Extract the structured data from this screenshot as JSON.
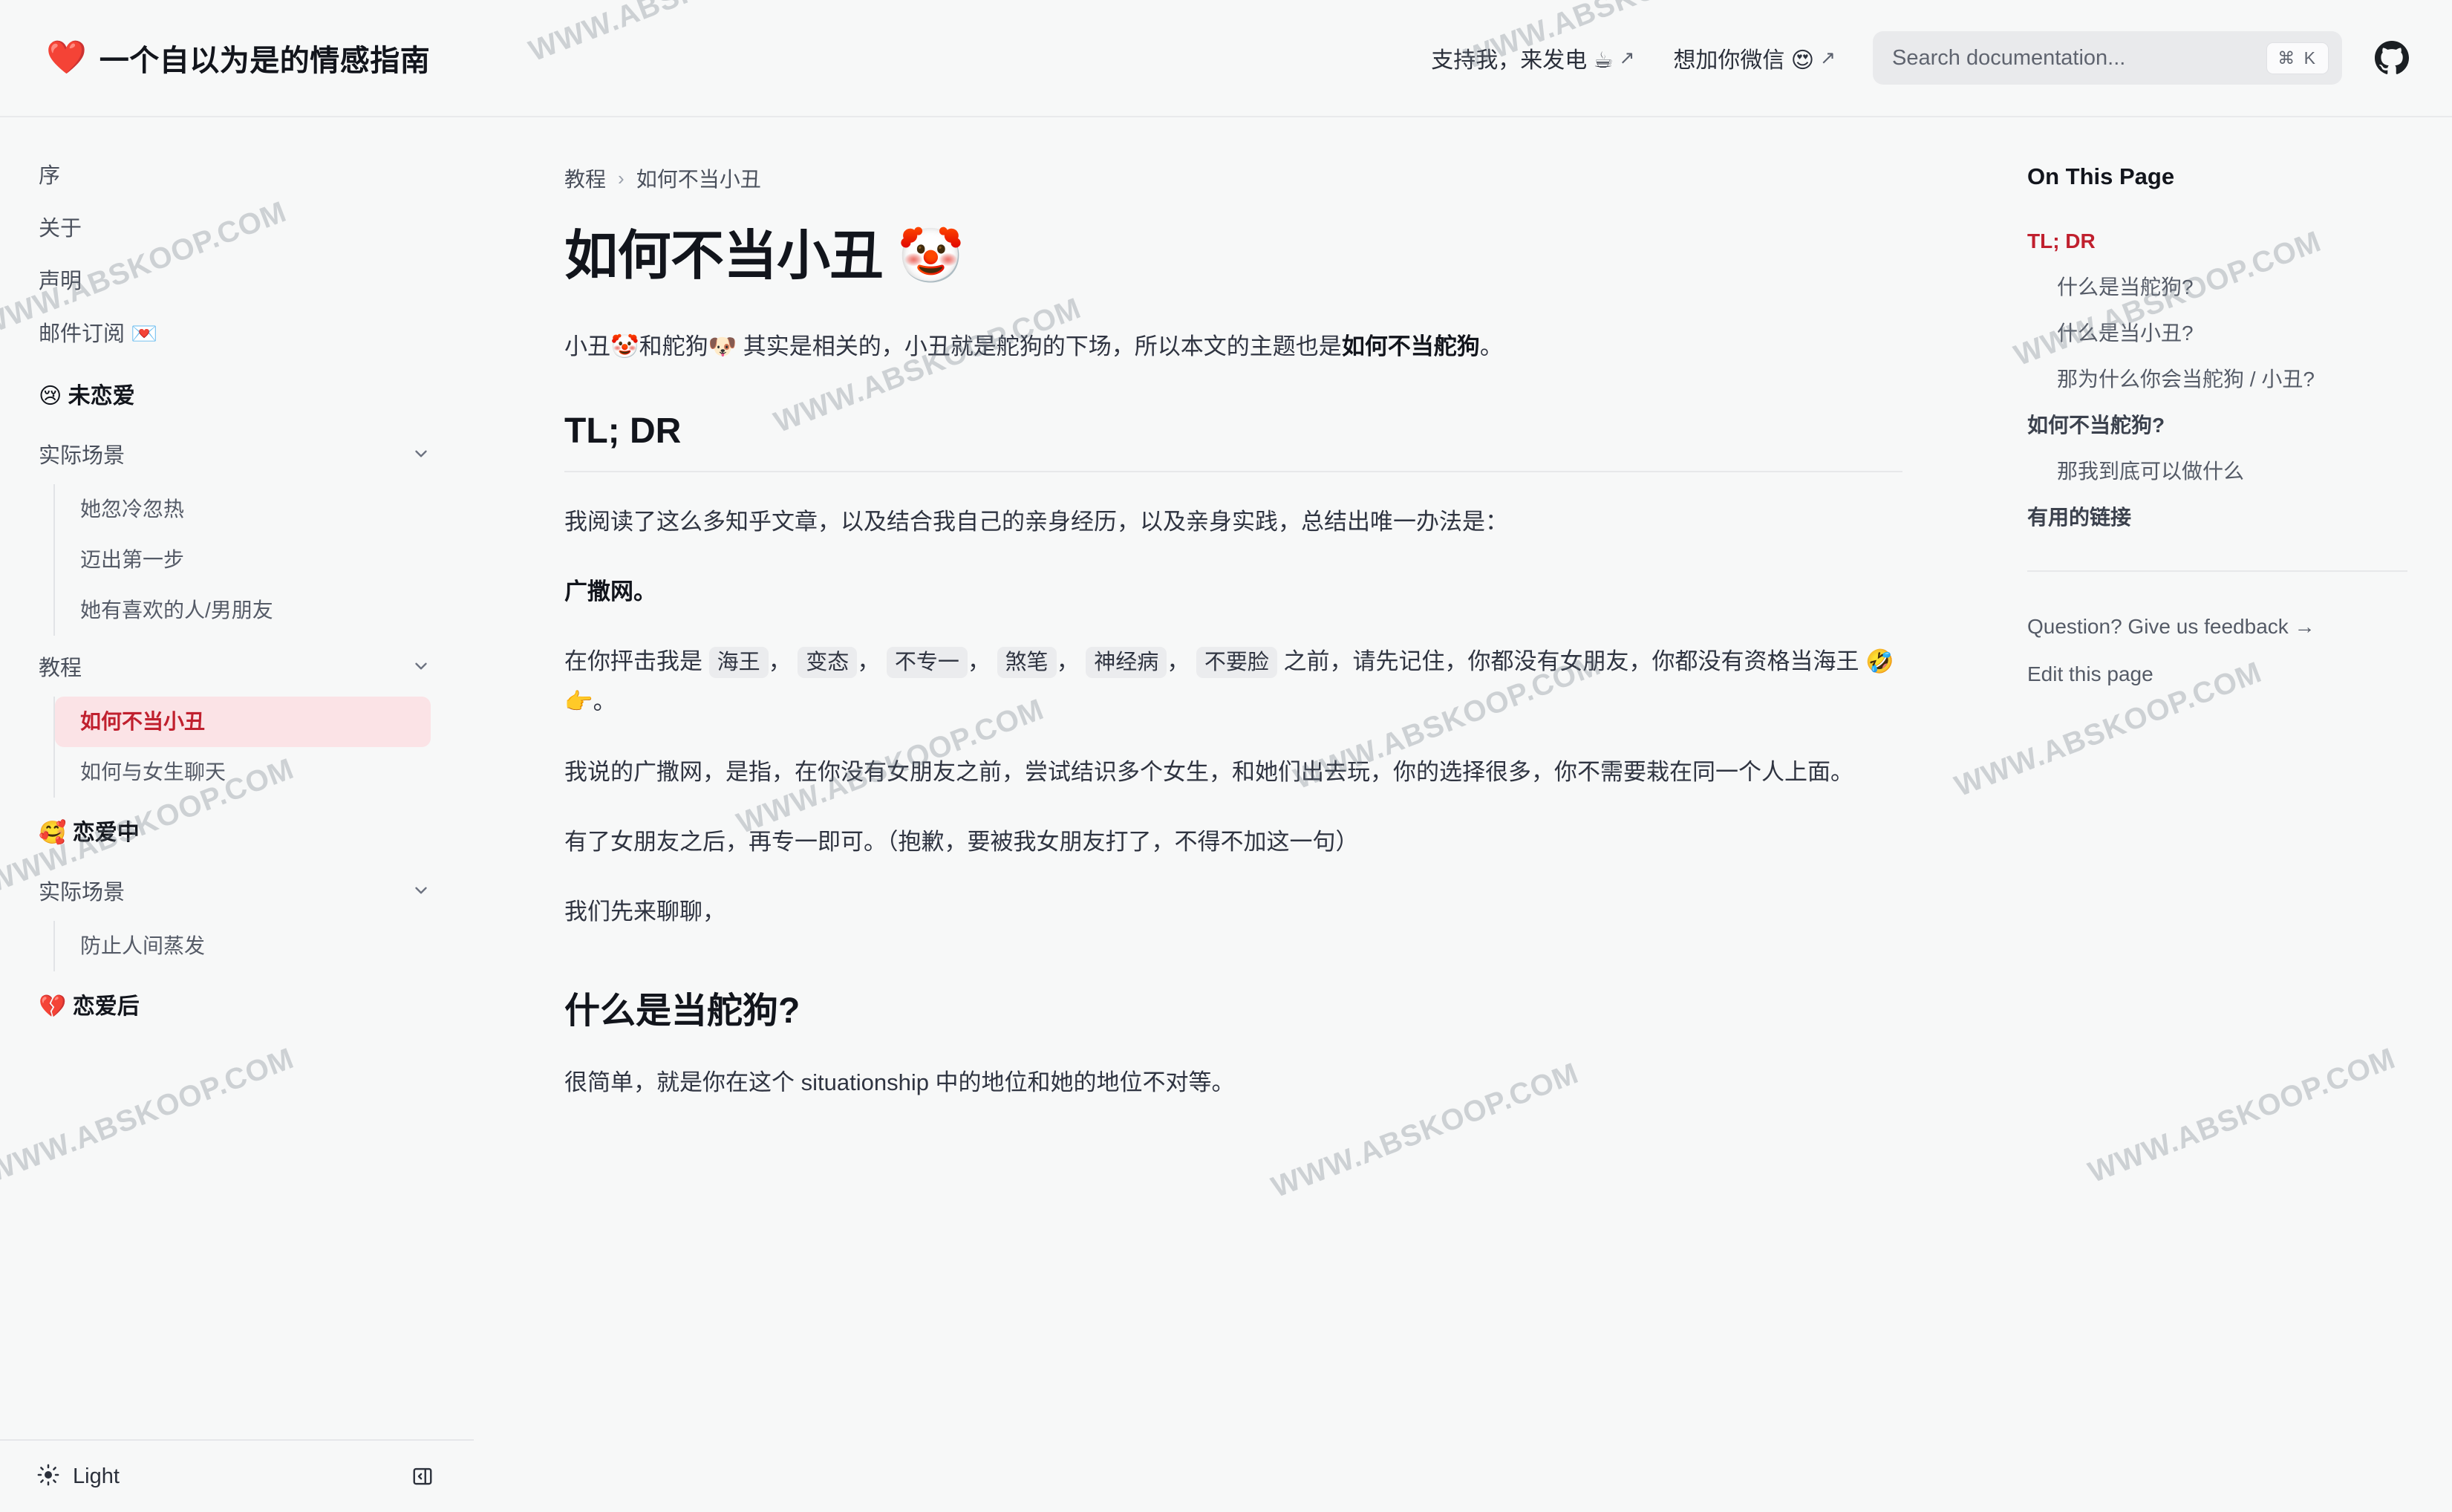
{
  "header": {
    "brand_icon": "heart-icon",
    "brand_heart": "❤️",
    "brand_title": "一个自以为是的情感指南",
    "nav": [
      {
        "label": "支持我，来发电 ☕",
        "arrow": "↗"
      },
      {
        "label": "想加你微信 😍",
        "arrow": "↗"
      }
    ],
    "search": {
      "placeholder": "Search documentation...",
      "kbd": "⌘ K"
    },
    "github_label": "github-icon"
  },
  "sidebar": {
    "top_items": [
      {
        "label": "序"
      },
      {
        "label": "关于"
      },
      {
        "label": "声明"
      },
      {
        "label": "邮件订阅 💌"
      }
    ],
    "sections": [
      {
        "heading": "😢 未恋爱",
        "groups": [
          {
            "label": "实际场景",
            "children": [
              {
                "label": "她忽冷忽热",
                "active": false
              },
              {
                "label": "迈出第一步",
                "active": false
              },
              {
                "label": "她有喜欢的人/男朋友",
                "active": false
              }
            ]
          },
          {
            "label": "教程",
            "children": [
              {
                "label": "如何不当小丑",
                "active": true
              },
              {
                "label": "如何与女生聊天",
                "active": false
              }
            ]
          }
        ]
      },
      {
        "heading": "🥰 恋爱中",
        "groups": [
          {
            "label": "实际场景",
            "children": [
              {
                "label": "防止人间蒸发",
                "active": false
              }
            ]
          }
        ]
      },
      {
        "heading": "💔 恋爱后",
        "groups": []
      }
    ],
    "footer": {
      "theme_label": "Light",
      "theme_icon": "sun-icon",
      "collapse_icon": "sidebar-collapse-icon"
    }
  },
  "main": {
    "breadcrumb": [
      "教程",
      "如何不当小丑"
    ],
    "breadcrumb_sep": "›",
    "title": "如何不当小丑 🤡",
    "lead_part1": "小丑🤡和舵狗🐶 其实是相关的，小丑就是舵狗的下场，所以本文的主题也是",
    "lead_strong": "如何不当舵狗",
    "lead_part2": "。",
    "h2_tldr": "TL; DR",
    "p1": "我阅读了这么多知乎文章，以及结合我自己的亲身经历，以及亲身实践，总结出唯一办法是：",
    "p2_strong": "广撒网。",
    "p3_pre": "在你抨击我是",
    "p3_chips": [
      "海王",
      "变态",
      "不专一",
      "煞笔",
      "神经病",
      "不要脸"
    ],
    "p3_comma": "，",
    "p3_post": " 之前，请先记住，你都没有女朋友，你都没有资格当海王 🤣 👉。",
    "p4": "我说的广撒网，是指，在你没有女朋友之前，尝试结识多个女生，和她们出去玩，你的选择很多，你不需要栽在同一个人上面。",
    "p5": "有了女朋友之后，再专一即可。（抱歉，要被我女朋友打了，不得不加这一句）",
    "p6": "我们先来聊聊，",
    "h2_second": "什么是当舵狗?",
    "p7": "很简单，就是你在这个 situationship 中的地位和她的地位不对等。"
  },
  "toc": {
    "title": "On This Page",
    "items": [
      {
        "label": "TL; DR",
        "level": 2,
        "active": true
      },
      {
        "label": "什么是当舵狗?",
        "level": 3,
        "active": false
      },
      {
        "label": "什么是当小丑?",
        "level": 3,
        "active": false
      },
      {
        "label": "那为什么你会当舵狗 / 小丑?",
        "level": 3,
        "active": false
      },
      {
        "label": "如何不当舵狗?",
        "level": 2,
        "active": false
      },
      {
        "label": "那我到底可以做什么",
        "level": 3,
        "active": false
      },
      {
        "label": "有用的链接",
        "level": 2,
        "active": false
      }
    ],
    "footer_links": [
      {
        "label": "Question? Give us feedback →"
      },
      {
        "label": "Edit this page"
      }
    ]
  },
  "watermark": {
    "text": "WWW.ABSKOOP.COM"
  },
  "colors": {
    "accent_red": "#c0202e",
    "accent_red_bg": "#fbe3e6",
    "page_bg": "#f7f8f8",
    "text": "#12151c",
    "muted": "#555b67"
  }
}
